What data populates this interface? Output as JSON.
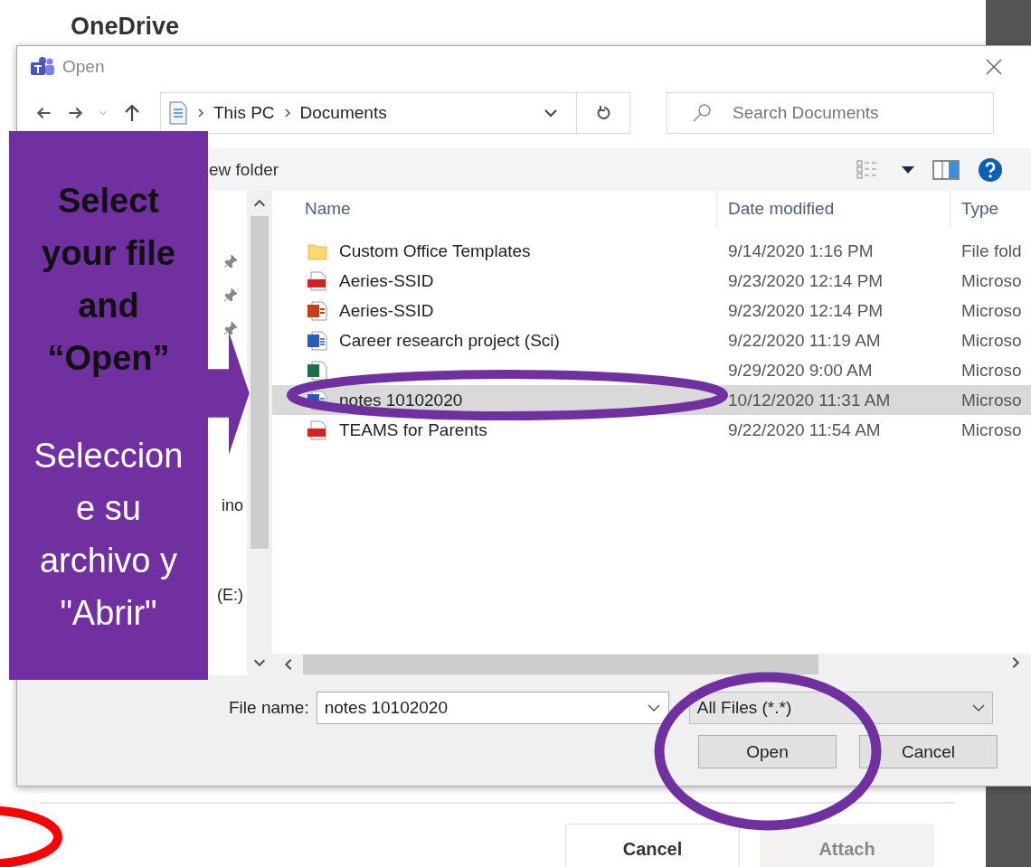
{
  "page": {
    "title": "OneDrive",
    "buttons": [
      {
        "label": "Cancel",
        "disabled": false
      },
      {
        "label": "Attach",
        "disabled": true
      }
    ]
  },
  "dialog": {
    "title": "Open",
    "path": [
      "This PC",
      "Documents"
    ],
    "search": {
      "placeholder": "Search Documents"
    },
    "new_folder": "ew folder",
    "nav_items": [
      {
        "label": "ino"
      },
      {
        "label": "(E:)"
      }
    ],
    "columns": [
      "Name",
      "Date modified",
      "Type"
    ],
    "rows": [
      {
        "kind": "folder",
        "name": "Custom Office Templates",
        "date": "9/14/2020 1:16 PM",
        "type": "File fold",
        "selected": false
      },
      {
        "kind": "pdf",
        "name": "Aeries-SSID",
        "date": "9/23/2020 12:14 PM",
        "type": "Microso",
        "selected": false
      },
      {
        "kind": "powerpoint",
        "name": "Aeries-SSID",
        "date": "9/23/2020 12:14 PM",
        "type": "Microso",
        "selected": false
      },
      {
        "kind": "word",
        "name": "Career research project (Sci)",
        "date": "9/22/2020 11:19 AM",
        "type": "Microso",
        "selected": false
      },
      {
        "kind": "excel",
        "date": "9/29/2020 9:00 AM",
        "type": "Microso",
        "selected": false
      },
      {
        "kind": "word",
        "name": "notes 10102020",
        "date": "10/12/2020 11:31 AM",
        "type": "Microso",
        "selected": true
      },
      {
        "kind": "pdf",
        "name": "TEAMS for Parents",
        "date": "9/22/2020 11:54 AM",
        "type": "Microso",
        "selected": false
      }
    ],
    "file_name": {
      "label": "File name:",
      "value": "notes 10102020"
    },
    "file_type": "All Files (*.*)",
    "buttons": [
      "Open",
      "Cancel"
    ]
  },
  "annotation": {
    "english_lines": [
      "Select",
      "your file",
      "and",
      "“Open”"
    ],
    "spanish_lines": [
      "Seleccion",
      "e su",
      "archivo y",
      "\"Abrir\""
    ]
  }
}
